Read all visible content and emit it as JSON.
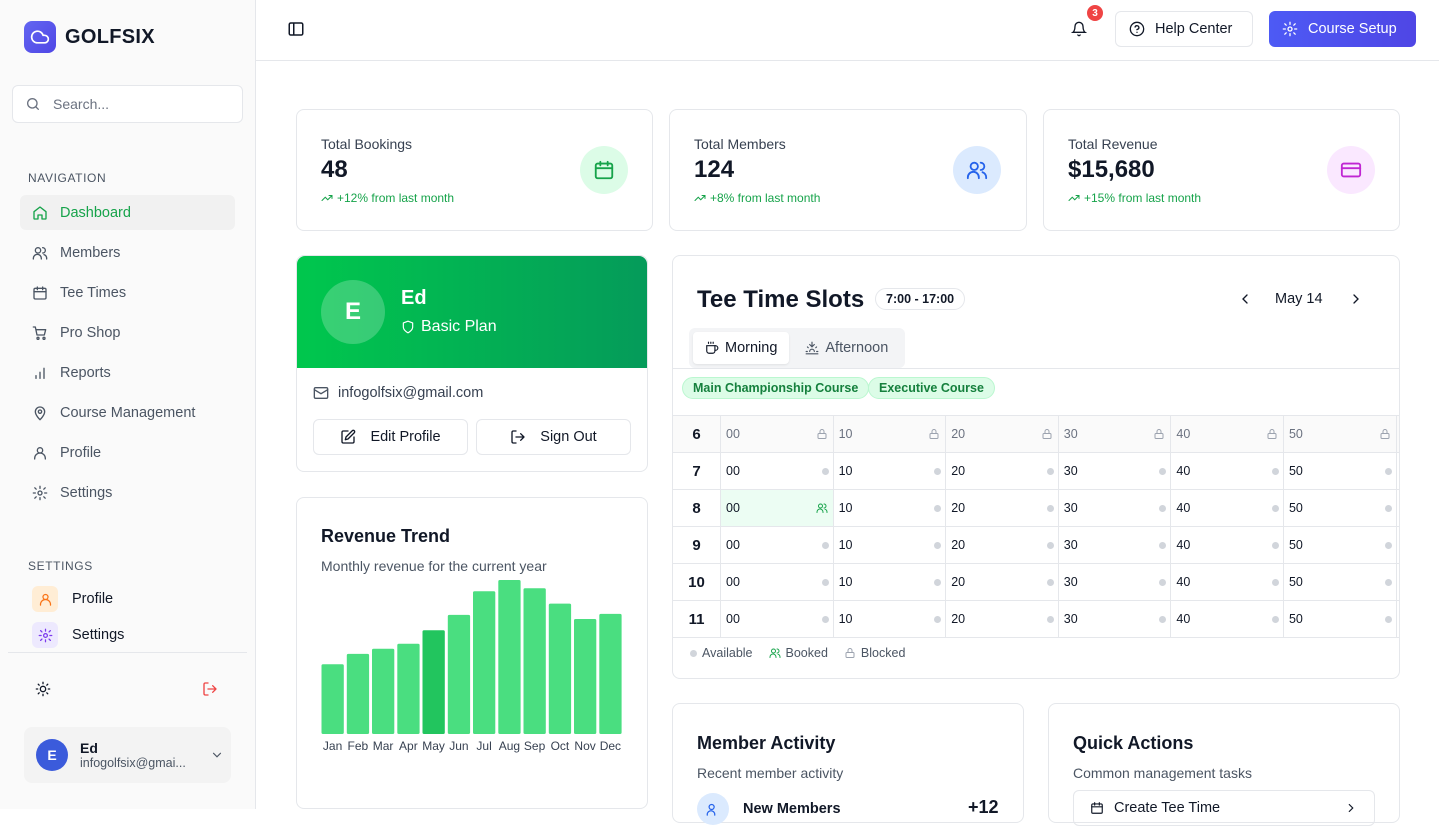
{
  "app": {
    "name": "GOLFSIX"
  },
  "search": {
    "placeholder": "Search..."
  },
  "sidebar": {
    "nav_heading": "NAVIGATION",
    "items": [
      {
        "label": "Dashboard",
        "icon": "home-icon",
        "active": true
      },
      {
        "label": "Members",
        "icon": "users-icon"
      },
      {
        "label": "Tee Times",
        "icon": "calendar-icon"
      },
      {
        "label": "Pro Shop",
        "icon": "cart-icon"
      },
      {
        "label": "Reports",
        "icon": "bar-chart-icon"
      },
      {
        "label": "Course Management",
        "icon": "map-pin-icon"
      },
      {
        "label": "Profile",
        "icon": "user-icon"
      },
      {
        "label": "Settings",
        "icon": "gear-icon"
      }
    ],
    "settings_heading": "SETTINGS",
    "settings_items": [
      {
        "label": "Profile",
        "icon": "user-icon",
        "color": "#f97316"
      },
      {
        "label": "Settings",
        "icon": "gear-icon",
        "color": "#7c3aed"
      }
    ],
    "user": {
      "initial": "E",
      "name": "Ed",
      "email": "infogolfsix@gmai..."
    }
  },
  "topbar": {
    "notifications_count": "3",
    "help_label": "Help Center",
    "setup_label": "Course Setup"
  },
  "stats": [
    {
      "label": "Total Bookings",
      "value": "48",
      "trend": "+12% from last month",
      "icon": "calendar-icon",
      "color": "#16a34a",
      "bg": "#dcfce7"
    },
    {
      "label": "Total Members",
      "value": "124",
      "trend": "+8% from last month",
      "icon": "users-icon",
      "color": "#2563eb",
      "bg": "#dbeafe"
    },
    {
      "label": "Total Revenue",
      "value": "$15,680",
      "trend": "+15% from last month",
      "icon": "credit-card-icon",
      "color": "#c026d3",
      "bg": "#fae8ff"
    }
  ],
  "profile_card": {
    "initial": "E",
    "name": "Ed",
    "plan": "Basic Plan",
    "email": "infogolfsix@gmail.com",
    "edit_label": "Edit Profile",
    "signout_label": "Sign Out"
  },
  "revenue": {
    "title": "Revenue Trend",
    "subtitle": "Monthly revenue for the current year"
  },
  "chart_data": {
    "type": "bar",
    "title": "Revenue Trend",
    "categories": [
      "Jan",
      "Feb",
      "Mar",
      "Apr",
      "May",
      "Jun",
      "Jul",
      "Aug",
      "Sep",
      "Oct",
      "Nov",
      "Dec"
    ],
    "values": [
      68,
      78,
      83,
      88,
      101,
      116,
      139,
      150,
      142,
      127,
      112,
      117
    ],
    "highlight_index": 4,
    "ylim": [
      0,
      150
    ],
    "colors": {
      "bar": "#4ade80",
      "highlight": "#22c55e"
    }
  },
  "tee": {
    "title": "Tee Time Slots",
    "range": "7:00 - 17:00",
    "date": "May 14",
    "tabs": [
      {
        "label": "Morning",
        "icon": "coffee-icon",
        "active": true
      },
      {
        "label": "Afternoon",
        "icon": "sunset-icon"
      }
    ],
    "courses": [
      "Main Championship Course",
      "Executive Course"
    ],
    "minutes": [
      "00",
      "10",
      "20",
      "30",
      "40",
      "50"
    ],
    "rows": [
      {
        "hour": "6",
        "status": [
          "blocked",
          "blocked",
          "blocked",
          "blocked",
          "blocked",
          "blocked"
        ]
      },
      {
        "hour": "7",
        "status": [
          "available",
          "available",
          "available",
          "available",
          "available",
          "available"
        ]
      },
      {
        "hour": "8",
        "status": [
          "booked",
          "available",
          "available",
          "available",
          "available",
          "available"
        ]
      },
      {
        "hour": "9",
        "status": [
          "available",
          "available",
          "available",
          "available",
          "available",
          "available"
        ]
      },
      {
        "hour": "10",
        "status": [
          "available",
          "available",
          "available",
          "available",
          "available",
          "available"
        ]
      },
      {
        "hour": "11",
        "status": [
          "available",
          "available",
          "available",
          "available",
          "available",
          "available"
        ]
      }
    ],
    "legend": {
      "available": "Available",
      "booked": "Booked",
      "blocked": "Blocked"
    }
  },
  "member_activity": {
    "title": "Member Activity",
    "subtitle": "Recent member activity",
    "item_label": "New Members",
    "item_value": "+12"
  },
  "quick_actions": {
    "title": "Quick Actions",
    "subtitle": "Common management tasks",
    "first_label": "Create Tee Time"
  }
}
